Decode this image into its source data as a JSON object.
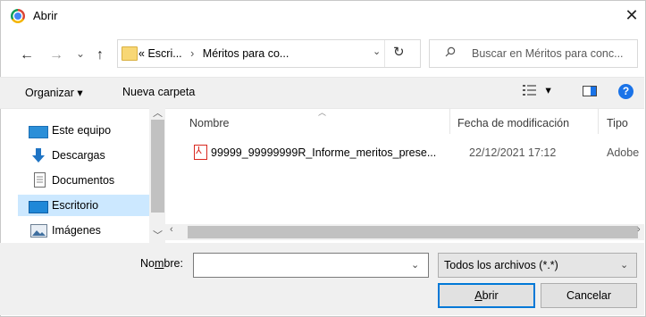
{
  "window": {
    "title": "Abrir",
    "close_glyph": "✕"
  },
  "nav": {
    "back_glyph": "←",
    "forward_glyph": "→",
    "recent_glyph": "⌄",
    "up_glyph": "↑",
    "breadcrumb": {
      "overflow": "«",
      "part1": "Escri...",
      "sep": "›",
      "part2": "Méritos para co..."
    },
    "address_dropdown_glyph": "⌄",
    "refresh_glyph": "↻",
    "search_placeholder": "Buscar en Méritos para conc..."
  },
  "toolbar": {
    "organize_label": "Organizar",
    "organize_caret": "▾",
    "new_folder_label": "Nueva carpeta",
    "view_caret": "▾",
    "help_glyph": "?"
  },
  "sidebar": {
    "items": [
      {
        "label": "Este equipo",
        "icon": "computer-icon"
      },
      {
        "label": "Descargas",
        "icon": "download-icon"
      },
      {
        "label": "Documentos",
        "icon": "documents-icon"
      },
      {
        "label": "Escritorio",
        "icon": "desktop-icon",
        "selected": true
      },
      {
        "label": "Imágenes",
        "icon": "pictures-icon"
      }
    ]
  },
  "columns": {
    "name": "Nombre",
    "date": "Fecha de modificación",
    "type": "Tipo"
  },
  "files": [
    {
      "name": "99999_99999999R_Informe_meritos_prese...",
      "date": "22/12/2021 17:12",
      "type": "Adobe",
      "icon": "pdf-icon"
    }
  ],
  "bottom": {
    "filename_label_pre": "No",
    "filename_label_access": "m",
    "filename_label_post": "bre:",
    "filename_value": "",
    "filetype_value": "Todos los archivos (*.*)",
    "open_label_access": "A",
    "open_label_rest": "brir",
    "cancel_label": "Cancelar"
  },
  "colors": {
    "accent": "#0078d7",
    "selection": "#cce8ff",
    "help": "#1a73e8"
  }
}
